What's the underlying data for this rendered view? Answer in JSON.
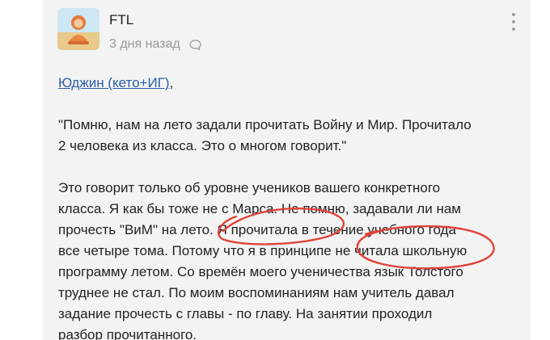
{
  "comment": {
    "author": "FTL",
    "time": "3 дня назад",
    "mention": "Юджин (кето+ИГ)",
    "mention_suffix": ",",
    "quote_lines": [
      "\"Помню, нам на лето задали прочитать Войну и Мир. Прочитало",
      "2 человека из класса. Это о многом говорит.\""
    ],
    "reply_lines": [
      "Это говорит только об уровне учеников вашего конкретного",
      "класса. Я как бы тоже не с Марса. Не помню, задавали ли нам",
      "прочесть \"ВиМ\" на лето. Я прочитала в течение учебного года",
      "все четыре тома. Потому что я в принципе не читала школьную",
      "программу летом. Со времён моего ученичества язык Толстого",
      "труднее не стал. По моим воспоминаниям нам учитель давал",
      "задание прочесть с главы - по главу. На занятии проходил",
      "разбор прочитанного."
    ]
  },
  "icons": {
    "reply": "speech-bubble-icon",
    "more": "vertical-dots-icon"
  },
  "colors": {
    "card_bg": "#f3f3f3",
    "mention": "#2b5ea8",
    "annotation": "#e0443a"
  }
}
